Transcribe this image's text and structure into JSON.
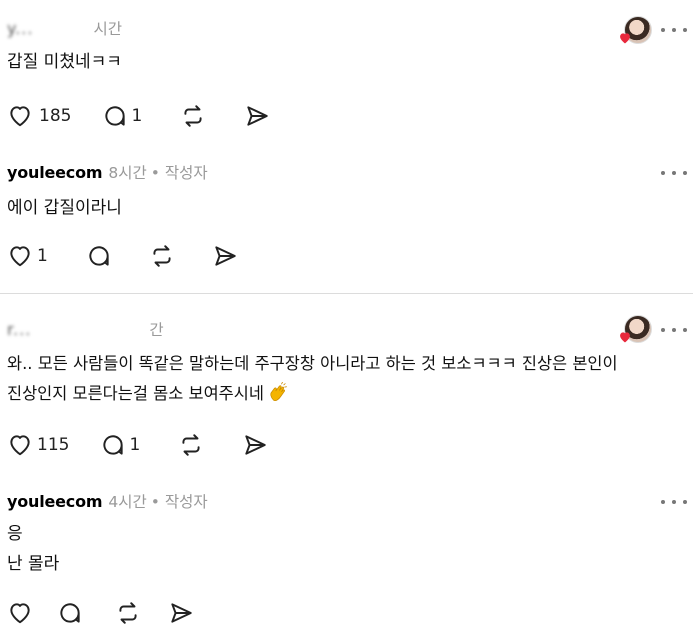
{
  "threads": [
    {
      "username": "y...",
      "time": "시간",
      "text": "갑질 미쳤네ㅋㅋ",
      "likes": "185",
      "replies": "1"
    },
    {
      "username": "youleecom",
      "time": "8시간",
      "role": "• 작성자",
      "text": "에이 갑질이라니",
      "likes": "1"
    },
    {
      "username": "r...",
      "time": "간",
      "text_line1": "와.. 모든 사람들이 똑같은 말하는데 주구장창 아니라고 하는 것 보소ㅋㅋㅋ 진상은 본인이",
      "text_line2": "진상인지 모른다는걸 몸소 보여주시네",
      "likes": "115",
      "replies": "1"
    },
    {
      "username": "youleecom",
      "time": "4시간",
      "role": "• 작성자",
      "text_line1": "응",
      "text_line2": "난 몰라"
    }
  ],
  "icons": {
    "like": "heart-icon",
    "reply": "comment-icon",
    "repost": "repost-icon",
    "share": "send-icon",
    "more": "more-icon",
    "clap": "clapping-hands-emoji"
  },
  "colors": {
    "meta_gray": "#9a9a9a",
    "divider": "#dcdcdc",
    "heart_red": "#e8283c",
    "emoji_yellow": "#f4b400"
  }
}
